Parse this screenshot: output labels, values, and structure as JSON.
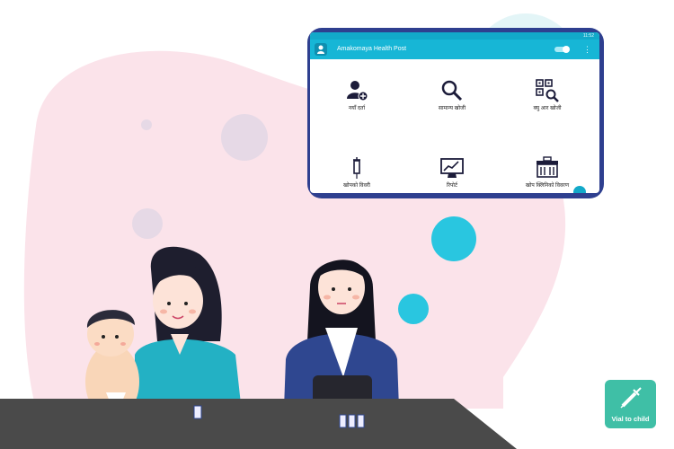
{
  "app": {
    "title": "Amakomaya Health Post",
    "status_time": "11:52",
    "menu_icon": "more-vert-icon"
  },
  "tiles": [
    {
      "label": "नयाँ दर्ता",
      "icon": "add-user-icon"
    },
    {
      "label": "सामान्य खोजी",
      "icon": "search-icon"
    },
    {
      "label": "क्यु आर खोजी",
      "icon": "qr-search-icon"
    },
    {
      "label": "खोपको विवरी",
      "icon": "syringe-icon"
    },
    {
      "label": "रिपोर्ट",
      "icon": "report-monitor-icon"
    },
    {
      "label": "खोप क्लिनिको विवरण",
      "icon": "clinic-icon"
    }
  ],
  "badge": {
    "label": "Vial to child",
    "icon": "syringe-badge-icon"
  },
  "colors": {
    "accent": "#17b6d6",
    "tablet_frame": "#2e3f8f",
    "blob_pink": "#fbe3ea",
    "badge": "#3fbfa6",
    "table": "#4a4a4a"
  }
}
